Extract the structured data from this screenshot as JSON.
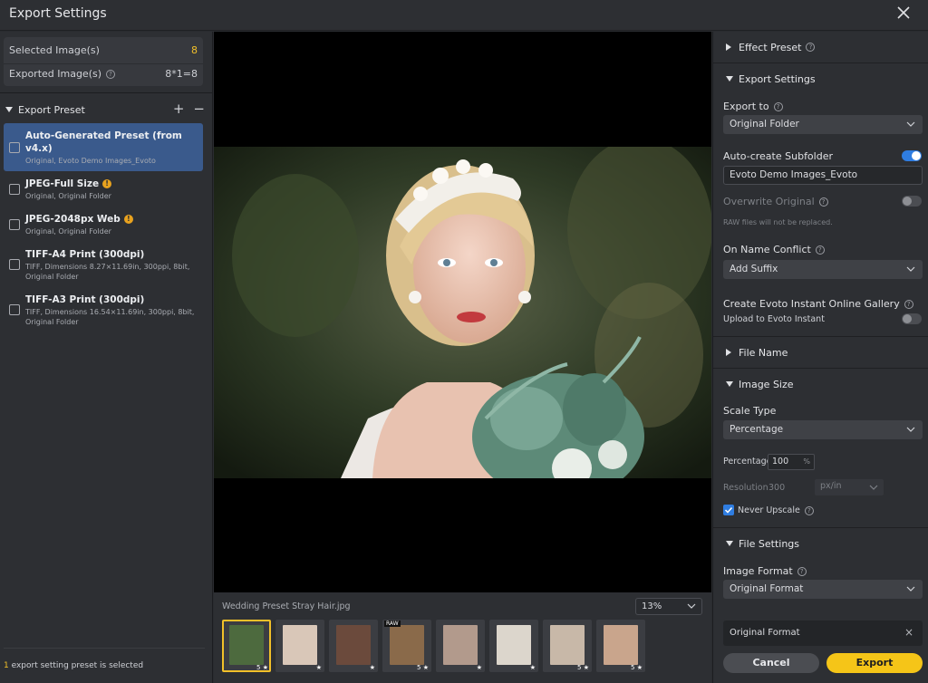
{
  "window": {
    "title": "Export Settings"
  },
  "stats": {
    "selected_label": "Selected Image(s)",
    "selected_value": "8",
    "exported_label": "Exported Image(s)",
    "exported_value": "8*1=8"
  },
  "preset_section": {
    "title": "Export Preset",
    "add": "+",
    "remove": "−"
  },
  "presets": [
    {
      "name": "Auto-Generated Preset (from v4.x)",
      "desc": "Original, Evoto Demo Images_Evoto",
      "selected": true,
      "warn": false
    },
    {
      "name": "JPEG-Full Size",
      "desc": "Original, Original Folder",
      "selected": false,
      "warn": true
    },
    {
      "name": "JPEG-2048px Web",
      "desc": "Original, Original Folder",
      "selected": false,
      "warn": true
    },
    {
      "name": "TIFF-A4 Print (300dpi)",
      "desc": "TIFF, Dimensions 8.27×11.69in, 300ppi, 8bit, Original Folder",
      "selected": false,
      "warn": false
    },
    {
      "name": "TIFF-A3 Print (300dpi)",
      "desc": "TIFF, Dimensions 16.54×11.69in, 300ppi, 8bit, Original Folder",
      "selected": false,
      "warn": false
    }
  ],
  "footer": {
    "count": "1",
    "text": " export setting preset is selected"
  },
  "viewer": {
    "filename": "Wedding Preset Stray Hair.jpg",
    "zoom": "13%",
    "thumbnails": [
      {
        "tag": "",
        "rating": "5 ★",
        "color": "#4d6a3e",
        "active": true
      },
      {
        "tag": "",
        "rating": "★",
        "color": "#d9c7b8",
        "active": false
      },
      {
        "tag": "",
        "rating": "★",
        "color": "#6b4a3c",
        "active": false
      },
      {
        "tag": "RAW",
        "rating": "5 ★",
        "color": "#8a6a4a",
        "active": false
      },
      {
        "tag": "",
        "rating": "★",
        "color": "#b29a8c",
        "active": false
      },
      {
        "tag": "",
        "rating": "★",
        "color": "#dcd6cc",
        "active": false
      },
      {
        "tag": "",
        "rating": "5 ★",
        "color": "#c8b8a8",
        "active": false
      },
      {
        "tag": "",
        "rating": "5 ★",
        "color": "#c9a58c",
        "active": false
      }
    ]
  },
  "right": {
    "effect_preset": "Effect Preset",
    "export_settings": "Export Settings",
    "export_to_label": "Export to",
    "export_to_value": "Original Folder",
    "subfolder_label": "Auto-create Subfolder",
    "subfolder_on": true,
    "subfolder_value": "Evoto Demo Images_Evoto",
    "overwrite_label": "Overwrite Original",
    "overwrite_on": false,
    "overwrite_note": "RAW files will not be replaced.",
    "name_conflict_label": "On Name Conflict",
    "name_conflict_value": "Add Suffix",
    "gallery_label": "Create Evoto Instant Online Gallery",
    "gallery_sub": "Upload to Evoto Instant",
    "gallery_on": false,
    "file_name": "File Name",
    "image_size": "Image Size",
    "scale_type_label": "Scale Type",
    "scale_type_value": "Percentage",
    "percentage_label": "Percentage",
    "percentage_value": "100",
    "percentage_unit": "%",
    "resolution_label": "Resolution",
    "resolution_value": "300",
    "resolution_unit": "px/in",
    "never_upscale_label": "Never Upscale",
    "never_upscale_checked": true,
    "file_settings": "File Settings",
    "image_format_label": "Image Format",
    "image_format_value": "Original Format",
    "format_card": "Original Format",
    "cancel": "Cancel",
    "export": "Export"
  },
  "colors": {
    "accent": "#f5c518",
    "toggle_on": "#2f7de1",
    "selected_preset": "#3a5a8c",
    "warning": "#e8a21e"
  }
}
